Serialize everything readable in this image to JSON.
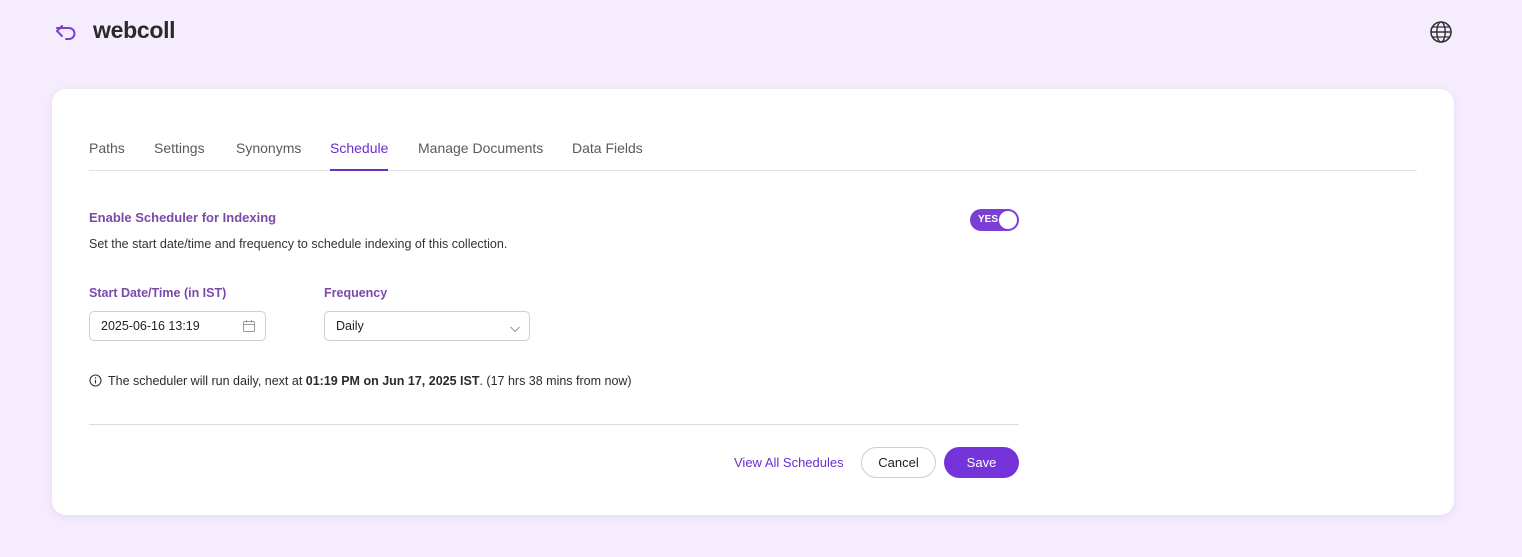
{
  "header": {
    "back_icon": "back-arrow-icon",
    "title": "webcoll",
    "language_icon": "globe-icon"
  },
  "tabs": [
    {
      "label": "Paths",
      "active": false
    },
    {
      "label": "Settings",
      "active": false
    },
    {
      "label": "Synonyms",
      "active": false
    },
    {
      "label": "Schedule",
      "active": true
    },
    {
      "label": "Manage Documents",
      "active": false
    },
    {
      "label": "Data Fields",
      "active": false
    }
  ],
  "scheduler": {
    "title": "Enable Scheduler for Indexing",
    "description": "Set the start date/time and frequency to schedule indexing of this collection.",
    "toggle_label": "YES",
    "enabled": true
  },
  "form": {
    "start_label": "Start Date/Time (in IST)",
    "start_value": "2025-06-16 13:19",
    "frequency_label": "Frequency",
    "frequency_value": "Daily"
  },
  "info": {
    "prefix": "The scheduler will run daily, next at ",
    "highlight": "01:19 PM on Jun 17, 2025 IST",
    "suffix": ". (17 hrs 38 mins from now)"
  },
  "actions": {
    "view_all_label": "View All Schedules",
    "cancel_label": "Cancel",
    "save_label": "Save"
  },
  "colors": {
    "accent": "#7434da",
    "label": "#7a4aa8",
    "background": "#f5ecfd"
  }
}
